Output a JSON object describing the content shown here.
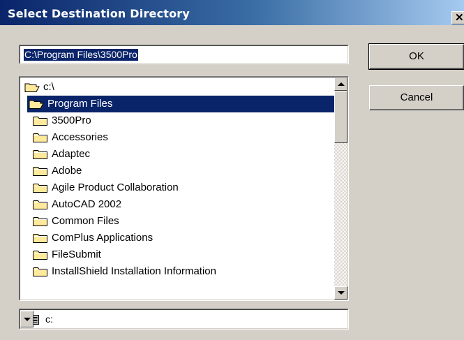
{
  "window": {
    "title": "Select Destination Directory",
    "close_glyph": "✕"
  },
  "path_field": {
    "value": "C:\\Program Files\\3500Pro"
  },
  "buttons": {
    "ok": "OK",
    "cancel": "Cancel"
  },
  "directory_list": {
    "items": [
      {
        "label": "c:\\",
        "icon": "open-folder-icon",
        "level": 0,
        "selected": false
      },
      {
        "label": "Program Files",
        "icon": "open-folder-icon",
        "level": 1,
        "selected": true
      },
      {
        "label": "3500Pro",
        "icon": "folder-icon",
        "level": 2,
        "selected": false
      },
      {
        "label": "Accessories",
        "icon": "folder-icon",
        "level": 2,
        "selected": false
      },
      {
        "label": "Adaptec",
        "icon": "folder-icon",
        "level": 2,
        "selected": false
      },
      {
        "label": "Adobe",
        "icon": "folder-icon",
        "level": 2,
        "selected": false
      },
      {
        "label": "Agile Product Collaboration",
        "icon": "folder-icon",
        "level": 2,
        "selected": false
      },
      {
        "label": "AutoCAD 2002",
        "icon": "folder-icon",
        "level": 2,
        "selected": false
      },
      {
        "label": "Common Files",
        "icon": "folder-icon",
        "level": 2,
        "selected": false
      },
      {
        "label": "ComPlus Applications",
        "icon": "folder-icon",
        "level": 2,
        "selected": false
      },
      {
        "label": "FileSubmit",
        "icon": "folder-icon",
        "level": 2,
        "selected": false
      },
      {
        "label": "InstallShield Installation Information",
        "icon": "folder-icon",
        "level": 2,
        "selected": false
      }
    ]
  },
  "drive_select": {
    "value": "c:",
    "icon": "drive-icon"
  },
  "colors": {
    "selection": "#0a246a",
    "dialog_bg": "#d4d0c8",
    "folder": "#ffe99a"
  }
}
